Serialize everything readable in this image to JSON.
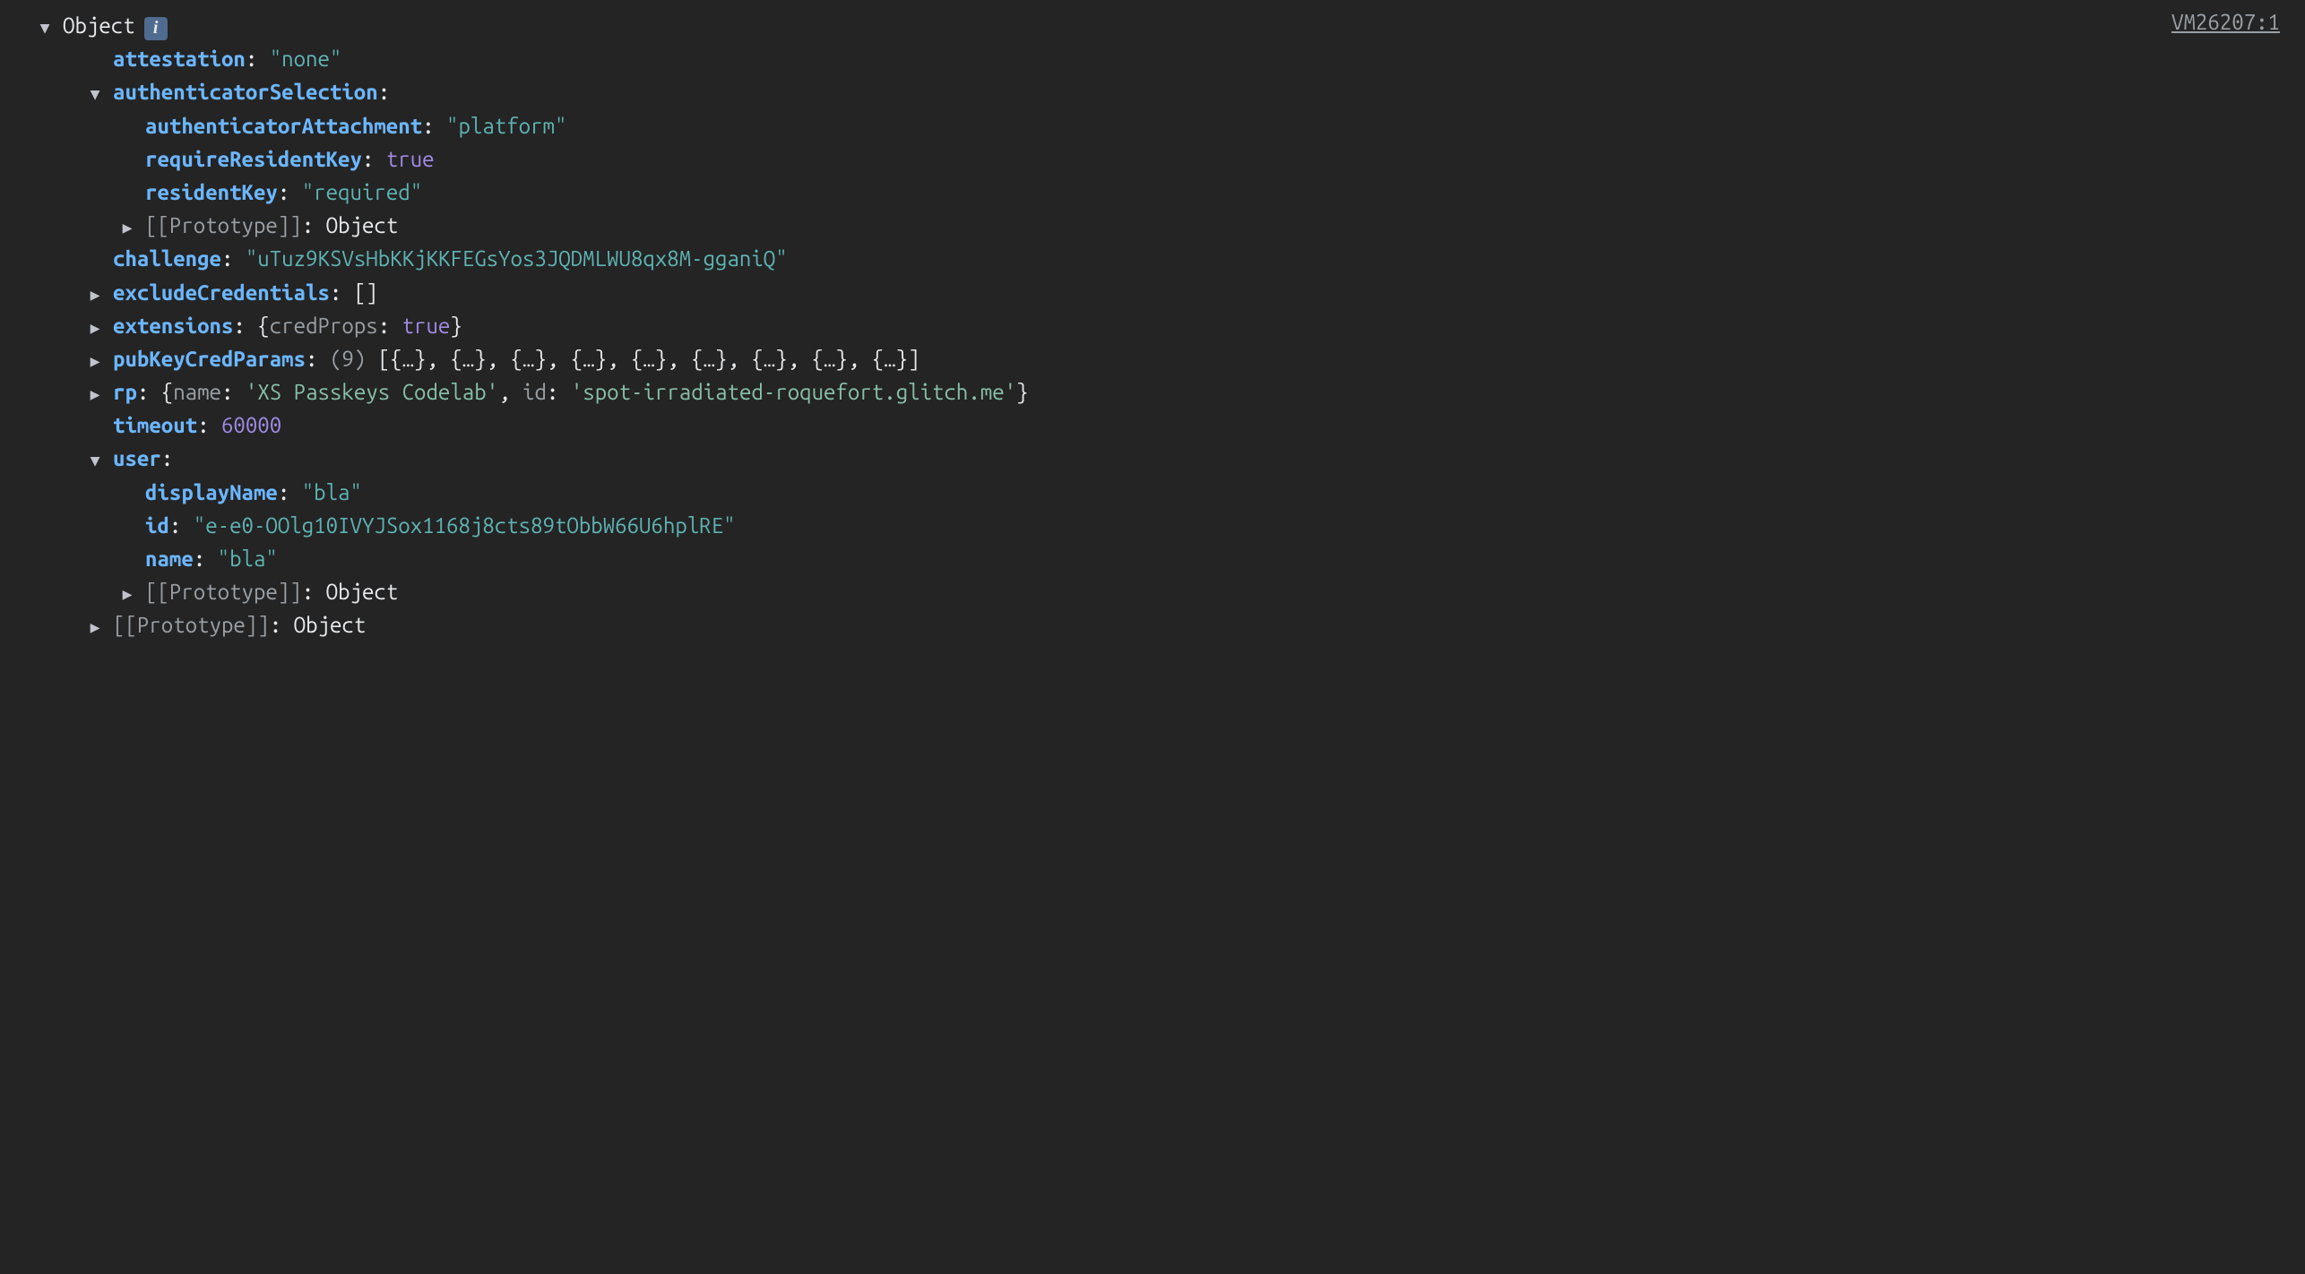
{
  "sourceLink": "VM26207:1",
  "root": {
    "label": "Object",
    "protoLabel": "[[Prototype]]",
    "protoValue": "Object"
  },
  "attestation": {
    "key": "attestation",
    "value": "\"none\""
  },
  "authenticatorSelection": {
    "key": "authenticatorSelection",
    "authenticatorAttachment": {
      "key": "authenticatorAttachment",
      "value": "\"platform\""
    },
    "requireResidentKey": {
      "key": "requireResidentKey",
      "value": "true"
    },
    "residentKey": {
      "key": "residentKey",
      "value": "\"required\""
    },
    "proto": {
      "key": "[[Prototype]]",
      "value": "Object"
    }
  },
  "challenge": {
    "key": "challenge",
    "value": "\"uTuz9KSVsHbKKjKKFEGsYos3JQDMLWU8qx8M-gganiQ\""
  },
  "excludeCredentials": {
    "key": "excludeCredentials",
    "value": "[]"
  },
  "extensions": {
    "key": "extensions",
    "preview": {
      "open": "{",
      "k": "credProps",
      "sep": ": ",
      "v": "true",
      "close": "}"
    }
  },
  "pubKeyCredParams": {
    "key": "pubKeyCredParams",
    "count": "(9)",
    "preview": "[{…}, {…}, {…}, {…}, {…}, {…}, {…}, {…}, {…}]"
  },
  "rp": {
    "key": "rp",
    "preview": {
      "open": "{",
      "k1": "name",
      "v1": "'XS Passkeys Codelab'",
      "k2": "id",
      "v2": "'spot-irradiated-roquefort.glitch.me'",
      "sep": ": ",
      "comma": ", ",
      "close": "}"
    }
  },
  "timeout": {
    "key": "timeout",
    "value": "60000"
  },
  "user": {
    "key": "user",
    "displayName": {
      "key": "displayName",
      "value": "\"bla\""
    },
    "id": {
      "key": "id",
      "value": "\"e-e0-OOlg10IVYJSox1168j8cts89tObbW66U6hplRE\""
    },
    "name": {
      "key": "name",
      "value": "\"bla\""
    },
    "proto": {
      "key": "[[Prototype]]",
      "value": "Object"
    }
  },
  "proto": {
    "key": "[[Prototype]]",
    "value": "Object"
  }
}
